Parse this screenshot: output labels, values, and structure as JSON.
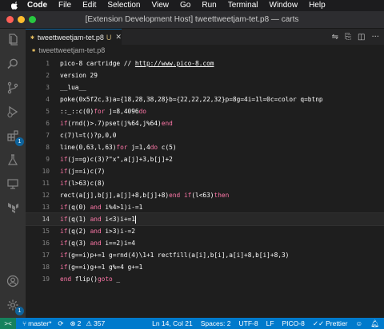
{
  "menubar": {
    "apple_icon": "apple-logo",
    "items": [
      "Code",
      "File",
      "Edit",
      "Selection",
      "View",
      "Go",
      "Run",
      "Terminal",
      "Window",
      "Help"
    ]
  },
  "window": {
    "title": "[Extension Development Host] tweettweetjam-tet.p8 — carts",
    "traffic_colors": [
      "#ff5f57",
      "#febc2e",
      "#28c840"
    ]
  },
  "activity_bar": {
    "explorer_icon": "files-icon",
    "search_icon": "search-icon",
    "source_control_icon": "source-control-icon",
    "run_icon": "run-debug-icon",
    "extensions_icon": "extensions-icon",
    "extensions_badge": "1",
    "test_icon": "flask-icon",
    "remote_icon": "remote-explorer-icon",
    "azure_icon": "terraform-icon",
    "account_icon": "account-icon",
    "settings_icon": "gear-icon",
    "settings_badge": "1"
  },
  "tab": {
    "label": "tweettweetjam-tet.p8",
    "modified": "U",
    "icon": "pico8-file-icon",
    "close_icon": "close-icon",
    "actions": [
      "split-icon",
      "open-changes-icon",
      "split-editor-icon",
      "more-icon"
    ]
  },
  "breadcrumb": {
    "file": "tweettweetjam-tet.p8",
    "icon": "pico8-file-icon"
  },
  "editor": {
    "current_line": 14,
    "lines": [
      {
        "n": "1",
        "tokens": [
          [
            "t",
            "pico-8 cartridge // "
          ],
          [
            "u",
            "http://www.pico-8.com"
          ]
        ]
      },
      {
        "n": "2",
        "tokens": [
          [
            "t",
            "version 29"
          ]
        ]
      },
      {
        "n": "3",
        "tokens": [
          [
            "t",
            "__lua__"
          ]
        ]
      },
      {
        "n": "4",
        "tokens": [
          [
            "t",
            "poke(0x5f2c,3)a={18,28,38,28}b={22,22,22,32}p=8g=4i=1l=0c=color q=btnp"
          ]
        ]
      },
      {
        "n": "5",
        "tokens": [
          [
            "t",
            "::_::c(0)"
          ],
          [
            "k",
            "for"
          ],
          [
            "t",
            " j=8,4096"
          ],
          [
            "k",
            "do"
          ]
        ]
      },
      {
        "n": "6",
        "tokens": [
          [
            "k",
            "if"
          ],
          [
            "t",
            "(rnd()>.7)pset(j%64,j%64)"
          ],
          [
            "k",
            "end"
          ]
        ]
      },
      {
        "n": "7",
        "tokens": [
          [
            "t",
            "c(7)l=t()?p,0,0"
          ]
        ]
      },
      {
        "n": "8",
        "tokens": [
          [
            "t",
            "line(0,63,l,63)"
          ],
          [
            "k",
            "for"
          ],
          [
            "t",
            " j=1,4"
          ],
          [
            "k",
            "do"
          ],
          [
            "t",
            " c(5)"
          ]
        ]
      },
      {
        "n": "9",
        "tokens": [
          [
            "k",
            "if"
          ],
          [
            "t",
            "(j==g)c(3)?\"x\",a[j]+3,b[j]+2"
          ]
        ]
      },
      {
        "n": "10",
        "tokens": [
          [
            "k",
            "if"
          ],
          [
            "t",
            "(j==i)c(7)"
          ]
        ]
      },
      {
        "n": "11",
        "tokens": [
          [
            "k",
            "if"
          ],
          [
            "t",
            "(l>63)c(8)"
          ]
        ]
      },
      {
        "n": "12",
        "tokens": [
          [
            "t",
            "rect(a[j],b[j],a[j]+8,b[j]+8)"
          ],
          [
            "k",
            "end"
          ],
          [
            "t",
            " "
          ],
          [
            "k",
            "if"
          ],
          [
            "t",
            "(l<63)"
          ],
          [
            "k",
            "then"
          ]
        ]
      },
      {
        "n": "13",
        "tokens": [
          [
            "k",
            "if"
          ],
          [
            "t",
            "(q(0) "
          ],
          [
            "k",
            "and"
          ],
          [
            "t",
            " i%4>1)i-=1"
          ]
        ]
      },
      {
        "n": "14",
        "tokens": [
          [
            "k",
            "if"
          ],
          [
            "t",
            "(q(1) "
          ],
          [
            "k",
            "and"
          ],
          [
            "t",
            " i<3)i+=1"
          ],
          [
            "c",
            ""
          ]
        ]
      },
      {
        "n": "15",
        "tokens": [
          [
            "k",
            "if"
          ],
          [
            "t",
            "(q(2) "
          ],
          [
            "k",
            "and"
          ],
          [
            "t",
            " i>3)i-=2"
          ]
        ]
      },
      {
        "n": "16",
        "tokens": [
          [
            "k",
            "if"
          ],
          [
            "t",
            "(q(3) "
          ],
          [
            "k",
            "and"
          ],
          [
            "t",
            " i==2)i=4"
          ]
        ]
      },
      {
        "n": "17",
        "tokens": [
          [
            "k",
            "if"
          ],
          [
            "t",
            "(g==i)p+=1 g=rnd(4)\\1+1 rectfill(a[i],b[i],a[i]+8,b[i]+8,3)"
          ]
        ]
      },
      {
        "n": "18",
        "tokens": [
          [
            "k",
            "if"
          ],
          [
            "t",
            "(g==i)g+=1 g%=4 g+=1"
          ]
        ]
      },
      {
        "n": "19",
        "tokens": [
          [
            "k",
            "end"
          ],
          [
            "t",
            " flip()"
          ],
          [
            "k",
            "goto"
          ],
          [
            "t",
            " _"
          ]
        ]
      }
    ]
  },
  "statusbar": {
    "remote_icon": "remote-icon",
    "branch_icon": "git-branch-icon",
    "branch": "master*",
    "sync_icon": "sync-icon",
    "errors_icon": "error-icon",
    "errors": "2",
    "warnings_icon": "warning-icon",
    "warnings": "357",
    "cursor_pos": "Ln 14, Col 21",
    "indent": "Spaces: 2",
    "encoding": "UTF-8",
    "eol": "LF",
    "language": "PICO-8",
    "prettier": "Prettier",
    "prettier_icon": "check-all-icon",
    "feedback_icon": "feedback-icon",
    "bell_icon": "bell-icon"
  }
}
